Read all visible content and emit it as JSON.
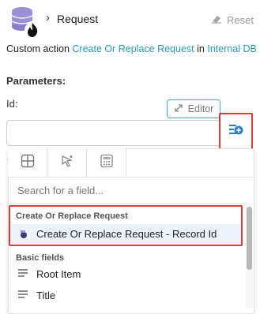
{
  "header": {
    "title": "Request",
    "reset_label": "Reset",
    "icons": {
      "app": "database-fire-icon",
      "chevron": "chevron-right-icon",
      "reset": "eraser-icon"
    }
  },
  "subtitle": {
    "prefix": "Custom action",
    "action_link": "Create Or Replace Request",
    "connector": "in",
    "db_link": "Internal DB"
  },
  "parameters": {
    "heading": "Parameters:",
    "field_label": "Id:",
    "editor_label": "Editor",
    "input_value": ""
  },
  "dropdown": {
    "tabs": [
      {
        "icon": "grid-icon",
        "active": true
      },
      {
        "icon": "pointer-select-icon",
        "active": false
      },
      {
        "icon": "calculator-icon",
        "active": false
      }
    ],
    "search_placeholder": "Search for a field...",
    "groups": [
      {
        "header": "Create Or Replace Request",
        "items": [
          {
            "label": "Create Or Replace Request - Record Id",
            "icon": "record-id-icon"
          }
        ]
      },
      {
        "header": "Basic fields",
        "items": [
          {
            "label": "Root Item",
            "icon": "list-icon"
          },
          {
            "label": "Title",
            "icon": "list-icon"
          }
        ]
      }
    ]
  },
  "colors": {
    "accent": "#2a9bb5",
    "highlight_border": "#e03b36",
    "selected_row": "#edf3fa"
  }
}
